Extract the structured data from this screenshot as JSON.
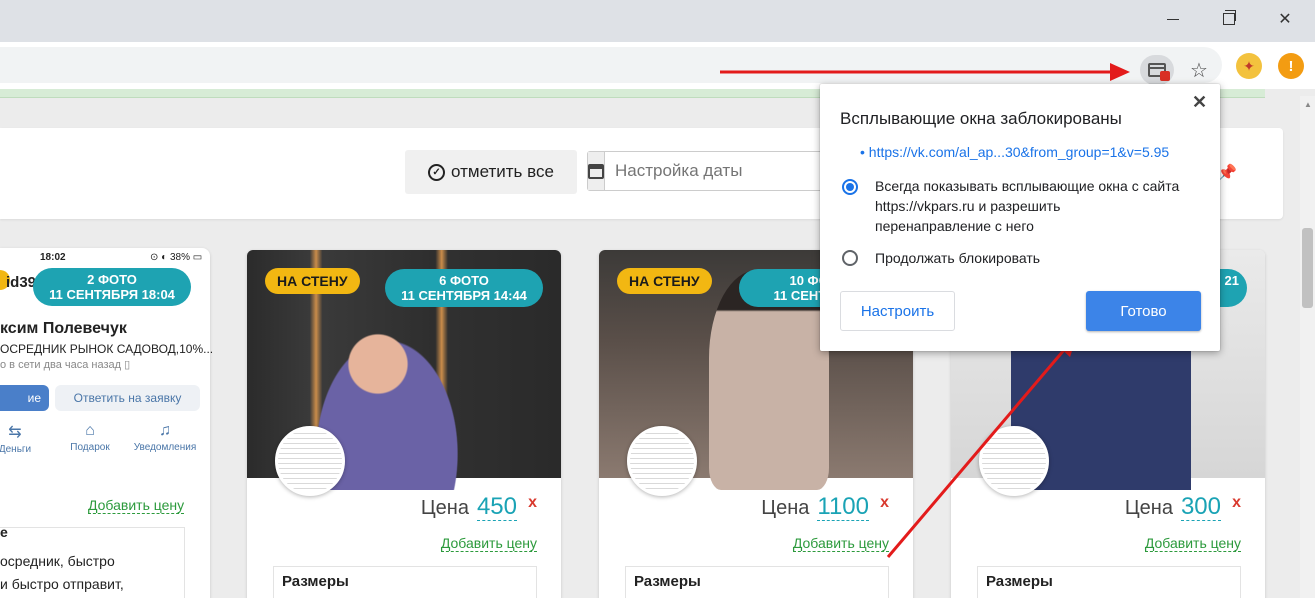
{
  "window": {
    "min_icon": "minimize-icon",
    "max_icon": "maximize-icon",
    "close_icon": "close-icon",
    "close_glyph": "✕"
  },
  "toolbar": {
    "star_glyph": "☆",
    "ext_alert_glyph": "!"
  },
  "page": {
    "mark_all_label": "отметить все",
    "date_placeholder": "Настройка даты"
  },
  "phone_card": {
    "time": "18:02",
    "battery": "⊙ ◐ 38% ▭",
    "user_id": "id39",
    "badge_line1": "2 ФОТО",
    "badge_line2": "11 СЕНТЯБРЯ 18:04",
    "name": "ксим Полевечук",
    "subtitle": "ОСРЕДНИК РЫНОК САДОВОД,10%...",
    "online": "о в сети два часа назад ▯",
    "btn_blue": "ие",
    "btn_gray": "Ответить на заявку",
    "tabs": [
      {
        "icon": "⇆",
        "label": "Деньги"
      },
      {
        "icon": "⌂",
        "label": "Подарок"
      },
      {
        "icon": "♫",
        "label": "Уведомления"
      }
    ],
    "add_price": "Добавить цену",
    "desc_title": "е",
    "desc_line1": "осредник, быстро",
    "desc_line2": "и быстро отправит,"
  },
  "cards": [
    {
      "wall_badge": "НА СТЕНУ",
      "photo_line1": "6 ФОТО",
      "photo_line2": "11 СЕНТЯБРЯ 14:44",
      "price_label": "Цена",
      "price": "450",
      "remove": "x",
      "add_price": "Добавить цену",
      "sizes": "Размеры"
    },
    {
      "wall_badge": "НА СТЕНУ",
      "photo_line1": "10 ФОТО",
      "photo_line2": "11 СЕНТЯБРЯ",
      "price_label": "Цена",
      "price": "1100",
      "remove": "x",
      "add_price": "Добавить цену",
      "sizes": "Размеры"
    },
    {
      "photo_line1": "",
      "photo_line2": "21",
      "price_label": "Цена",
      "price": "300",
      "remove": "x",
      "add_price": "Добавить цену",
      "sizes": "Размеры"
    }
  ],
  "popup": {
    "title": "Всплывающие окна заблокированы",
    "close_glyph": "✕",
    "link": "• https://vk.com/al_ap...30&from_group=1&v=5.95",
    "option_always_1": "Всегда показывать всплывающие окна с сайта",
    "option_always_2": "https://vkpars.ru и разрешить",
    "option_always_3": "перенаправление с него",
    "option_block": "Продолжать блокировать",
    "manage_button": "Настроить",
    "done_button": "Готово"
  },
  "colors": {
    "accent": "#1ea3b2",
    "badge_yellow": "#f2b712",
    "link_green": "#2c9a3c",
    "remove_red": "#d93a2f",
    "done_blue": "#3c84e8",
    "arrow_red": "#e31b1b"
  }
}
